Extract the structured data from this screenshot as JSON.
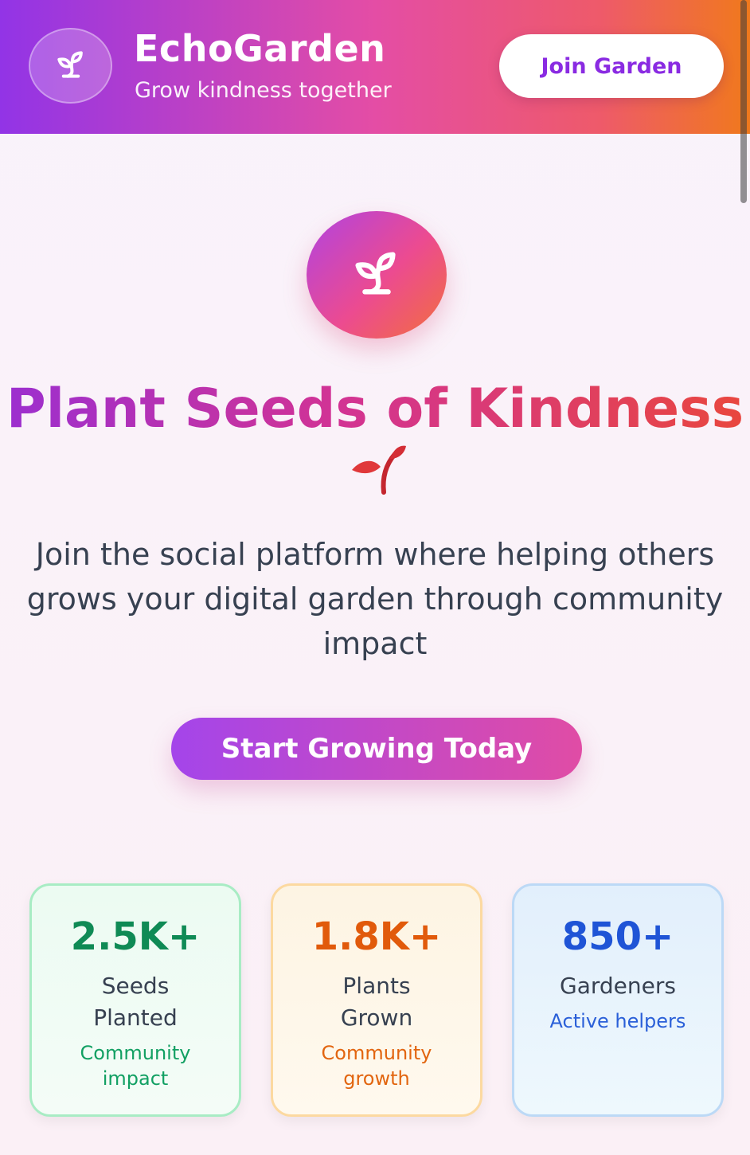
{
  "header": {
    "app_name": "EchoGarden",
    "tagline": "Grow kindness together",
    "join_label": "Join Garden",
    "logo_icon": "sprout-icon"
  },
  "hero": {
    "icon": "sprout-icon",
    "title": "Plant Seeds of Kindness",
    "title_emoji": "seedling-emoji",
    "description": "Join the social platform where helping others grows your digital garden through community impact",
    "cta_label": "Start Growing Today"
  },
  "stats": [
    {
      "value": "2.5K+",
      "label": "Seeds Planted",
      "note": "Community impact",
      "accent": "#0f8a55"
    },
    {
      "value": "1.8K+",
      "label": "Plants Grown",
      "note": "Community growth",
      "accent": "#e15a0b"
    },
    {
      "value": "850+",
      "label": "Gardeners",
      "note": "Active helpers",
      "accent": "#1f54d6"
    }
  ],
  "colors": {
    "header_gradient": [
      "#9234e6",
      "#e44da5",
      "#f0791c"
    ],
    "brand_purple": "#8a2be2"
  }
}
